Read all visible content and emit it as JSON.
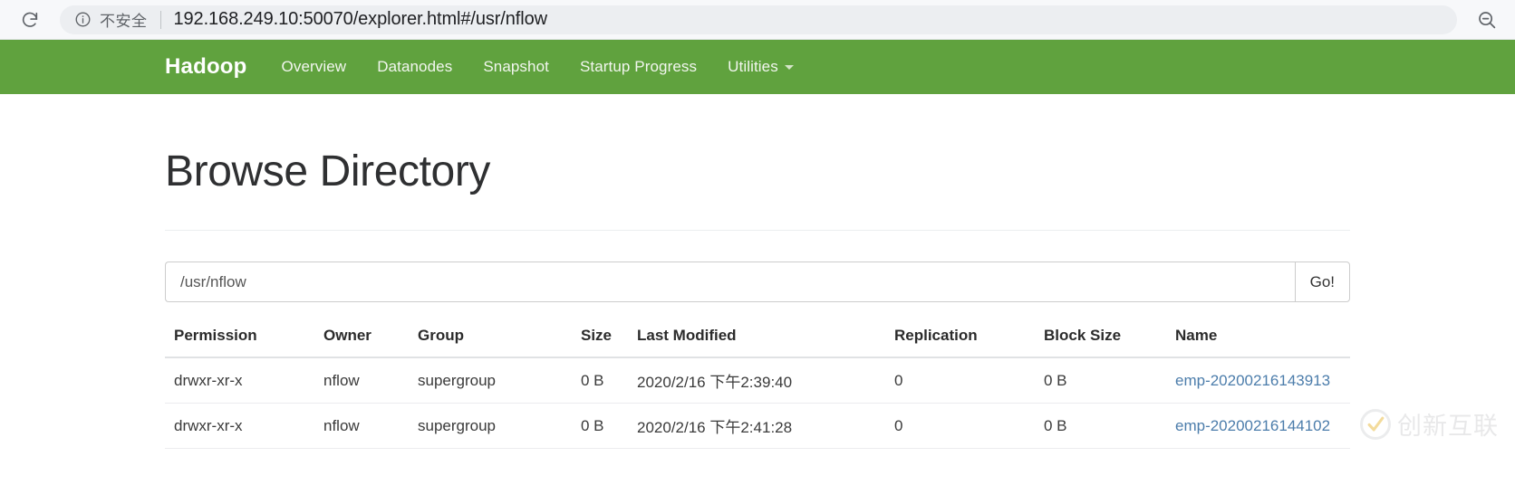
{
  "browser": {
    "reload_icon": "reload-icon",
    "info_icon": "info-circle-icon",
    "security_label": "不安全",
    "url": "192.168.249.10:50070/explorer.html#/usr/nflow",
    "zoom_icon": "zoom-out-icon"
  },
  "navbar": {
    "brand": "Hadoop",
    "accent_color": "#60a23e",
    "links": [
      {
        "label": "Overview",
        "caret": false
      },
      {
        "label": "Datanodes",
        "caret": false
      },
      {
        "label": "Snapshot",
        "caret": false
      },
      {
        "label": "Startup Progress",
        "caret": false
      },
      {
        "label": "Utilities",
        "caret": true
      }
    ]
  },
  "page": {
    "title": "Browse Directory"
  },
  "path_form": {
    "value": "/usr/nflow",
    "placeholder": "/usr/nflow",
    "go_label": "Go!"
  },
  "table": {
    "headers": [
      "Permission",
      "Owner",
      "Group",
      "Size",
      "Last Modified",
      "Replication",
      "Block Size",
      "Name"
    ],
    "rows": [
      {
        "permission": "drwxr-xr-x",
        "owner": "nflow",
        "group": "supergroup",
        "size": "0 B",
        "last_modified": "2020/2/16 下午2:39:40",
        "replication": "0",
        "block_size": "0 B",
        "name": "emp-20200216143913",
        "name_color": "#4c7dab"
      },
      {
        "permission": "drwxr-xr-x",
        "owner": "nflow",
        "group": "supergroup",
        "size": "0 B",
        "last_modified": "2020/2/16 下午2:41:28",
        "replication": "0",
        "block_size": "0 B",
        "name": "emp-20200216144102",
        "name_color": "#4c7dab"
      }
    ]
  },
  "watermark": {
    "text": "创新互联",
    "mark_icon": "check-circle-logo-icon"
  }
}
